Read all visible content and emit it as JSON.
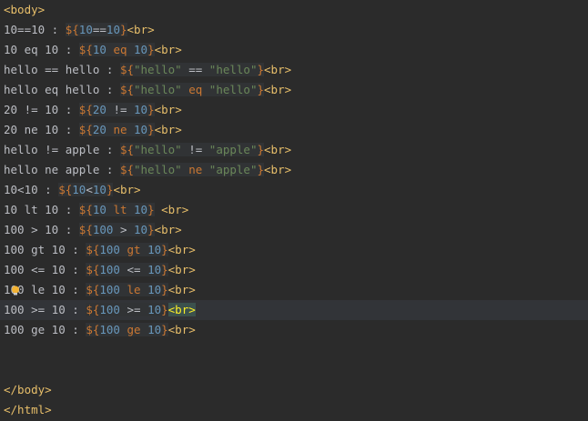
{
  "editor": {
    "lines": [
      {
        "segments": [
          {
            "t": "<body>",
            "c": "tag"
          }
        ]
      },
      {
        "segments": [
          {
            "t": "10==10 : ",
            "c": "plain"
          },
          {
            "t": "${",
            "c": "el"
          },
          {
            "t": "10",
            "c": "num"
          },
          {
            "t": "==",
            "c": "op"
          },
          {
            "t": "10",
            "c": "num"
          },
          {
            "t": "}",
            "c": "el"
          },
          {
            "t": "<br>",
            "c": "tag"
          }
        ]
      },
      {
        "segments": [
          {
            "t": "10 eq 10 : ",
            "c": "plain"
          },
          {
            "t": "${",
            "c": "el"
          },
          {
            "t": "10",
            "c": "num"
          },
          {
            "t": " eq ",
            "c": "kw"
          },
          {
            "t": "10",
            "c": "num"
          },
          {
            "t": "}",
            "c": "el"
          },
          {
            "t": "<br>",
            "c": "tag"
          }
        ]
      },
      {
        "segments": [
          {
            "t": "hello == hello : ",
            "c": "plain"
          },
          {
            "t": "${",
            "c": "el"
          },
          {
            "t": "\"hello\"",
            "c": "str"
          },
          {
            "t": " == ",
            "c": "op"
          },
          {
            "t": "\"hello\"",
            "c": "str"
          },
          {
            "t": "}",
            "c": "el"
          },
          {
            "t": "<br>",
            "c": "tag"
          }
        ]
      },
      {
        "segments": [
          {
            "t": "hello eq hello : ",
            "c": "plain"
          },
          {
            "t": "${",
            "c": "el"
          },
          {
            "t": "\"hello\"",
            "c": "str"
          },
          {
            "t": " eq ",
            "c": "kw"
          },
          {
            "t": "\"hello\"",
            "c": "str"
          },
          {
            "t": "}",
            "c": "el"
          },
          {
            "t": "<br>",
            "c": "tag"
          }
        ]
      },
      {
        "segments": [
          {
            "t": "20 != 10 : ",
            "c": "plain"
          },
          {
            "t": "${",
            "c": "el"
          },
          {
            "t": "20",
            "c": "num"
          },
          {
            "t": " != ",
            "c": "op"
          },
          {
            "t": "10",
            "c": "num"
          },
          {
            "t": "}",
            "c": "el"
          },
          {
            "t": "<br>",
            "c": "tag"
          }
        ]
      },
      {
        "segments": [
          {
            "t": "20 ne 10 : ",
            "c": "plain"
          },
          {
            "t": "${",
            "c": "el"
          },
          {
            "t": "20",
            "c": "num"
          },
          {
            "t": " ne ",
            "c": "kw"
          },
          {
            "t": "10",
            "c": "num"
          },
          {
            "t": "}",
            "c": "el"
          },
          {
            "t": "<br>",
            "c": "tag"
          }
        ]
      },
      {
        "segments": [
          {
            "t": "hello != apple : ",
            "c": "plain"
          },
          {
            "t": "${",
            "c": "el"
          },
          {
            "t": "\"hello\"",
            "c": "str"
          },
          {
            "t": " != ",
            "c": "op"
          },
          {
            "t": "\"apple\"",
            "c": "str"
          },
          {
            "t": "}",
            "c": "el"
          },
          {
            "t": "<br>",
            "c": "tag"
          }
        ]
      },
      {
        "segments": [
          {
            "t": "hello ne apple : ",
            "c": "plain"
          },
          {
            "t": "${",
            "c": "el"
          },
          {
            "t": "\"hello\"",
            "c": "str"
          },
          {
            "t": " ne ",
            "c": "kw"
          },
          {
            "t": "\"apple\"",
            "c": "str"
          },
          {
            "t": "}",
            "c": "el"
          },
          {
            "t": "<br>",
            "c": "tag"
          }
        ]
      },
      {
        "segments": [
          {
            "t": "10<10 : ",
            "c": "plain"
          },
          {
            "t": "${",
            "c": "el"
          },
          {
            "t": "10",
            "c": "num"
          },
          {
            "t": "<",
            "c": "op"
          },
          {
            "t": "10",
            "c": "num"
          },
          {
            "t": "}",
            "c": "el"
          },
          {
            "t": "<br>",
            "c": "tag"
          }
        ]
      },
      {
        "segments": [
          {
            "t": "10 lt 10 : ",
            "c": "plain"
          },
          {
            "t": "${",
            "c": "el"
          },
          {
            "t": "10",
            "c": "num"
          },
          {
            "t": " lt ",
            "c": "kw"
          },
          {
            "t": "10",
            "c": "num"
          },
          {
            "t": "}",
            "c": "el"
          },
          {
            "t": " <br>",
            "c": "tag"
          }
        ]
      },
      {
        "segments": [
          {
            "t": "100 > 10 : ",
            "c": "plain"
          },
          {
            "t": "${",
            "c": "el"
          },
          {
            "t": "100",
            "c": "num"
          },
          {
            "t": " > ",
            "c": "op"
          },
          {
            "t": "10",
            "c": "num"
          },
          {
            "t": "}",
            "c": "el"
          },
          {
            "t": "<br>",
            "c": "tag"
          }
        ]
      },
      {
        "segments": [
          {
            "t": "100 gt 10 : ",
            "c": "plain"
          },
          {
            "t": "${",
            "c": "el"
          },
          {
            "t": "100",
            "c": "num"
          },
          {
            "t": " gt ",
            "c": "kw"
          },
          {
            "t": "10",
            "c": "num"
          },
          {
            "t": "}",
            "c": "el"
          },
          {
            "t": "<br>",
            "c": "tag"
          }
        ]
      },
      {
        "segments": [
          {
            "t": "100 <= 10 : ",
            "c": "plain"
          },
          {
            "t": "${",
            "c": "el"
          },
          {
            "t": "100",
            "c": "num"
          },
          {
            "t": " <= ",
            "c": "op"
          },
          {
            "t": "10",
            "c": "num"
          },
          {
            "t": "}",
            "c": "el"
          },
          {
            "t": "<br>",
            "c": "tag"
          }
        ]
      },
      {
        "segments": [
          {
            "t": "100 le 10 : ",
            "c": "plain"
          },
          {
            "t": "${",
            "c": "el"
          },
          {
            "t": "100",
            "c": "num"
          },
          {
            "t": " le ",
            "c": "kw"
          },
          {
            "t": "10",
            "c": "num"
          },
          {
            "t": "}",
            "c": "el"
          },
          {
            "t": "<br>",
            "c": "tag"
          }
        ]
      },
      {
        "segments": [
          {
            "t": "100 >= 10 : ",
            "c": "plain"
          },
          {
            "t": "${",
            "c": "el"
          },
          {
            "t": "100",
            "c": "num"
          },
          {
            "t": " >= ",
            "c": "op"
          },
          {
            "t": "10",
            "c": "num"
          },
          {
            "t": "}",
            "c": "el"
          },
          {
            "t": "<br>",
            "c": "br-hl"
          }
        ],
        "current": true
      },
      {
        "segments": [
          {
            "t": "100 ge 10 : ",
            "c": "plain"
          },
          {
            "t": "${",
            "c": "el"
          },
          {
            "t": "100",
            "c": "num"
          },
          {
            "t": " ge ",
            "c": "kw"
          },
          {
            "t": "10",
            "c": "num"
          },
          {
            "t": "}",
            "c": "el"
          },
          {
            "t": "<br>",
            "c": "tag"
          }
        ]
      },
      {
        "segments": []
      },
      {
        "segments": []
      },
      {
        "segments": [
          {
            "t": "</body>",
            "c": "tag"
          }
        ]
      },
      {
        "segments": [
          {
            "t": "</html>",
            "c": "tag"
          }
        ]
      }
    ],
    "intention_bulb_icon": "lightbulb-icon"
  }
}
